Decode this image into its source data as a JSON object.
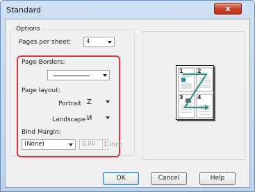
{
  "window": {
    "title": "Standard",
    "close_label": "x"
  },
  "options": {
    "legend": "Options",
    "pages_per_sheet": {
      "label": "Pages per sheet:",
      "value": "4"
    },
    "page_borders": {
      "label": "Page Borders:"
    },
    "page_layout": {
      "label": "Page layout:",
      "portrait": {
        "label": "Portrait",
        "glyph": "Z"
      },
      "landscape": {
        "label": "Landscape",
        "glyph": "И"
      }
    },
    "bind_margin": {
      "label": "Bind Margin:",
      "value": "(None)",
      "amount": "0.00",
      "unit": "inch"
    }
  },
  "preview": {
    "page_numbers": [
      "1",
      "2",
      "3",
      "4"
    ],
    "arrow_color": "#2f8f86"
  },
  "buttons": {
    "ok": "OK",
    "cancel": "Cancel",
    "help": "Help"
  },
  "highlight_color": "#d9363e"
}
